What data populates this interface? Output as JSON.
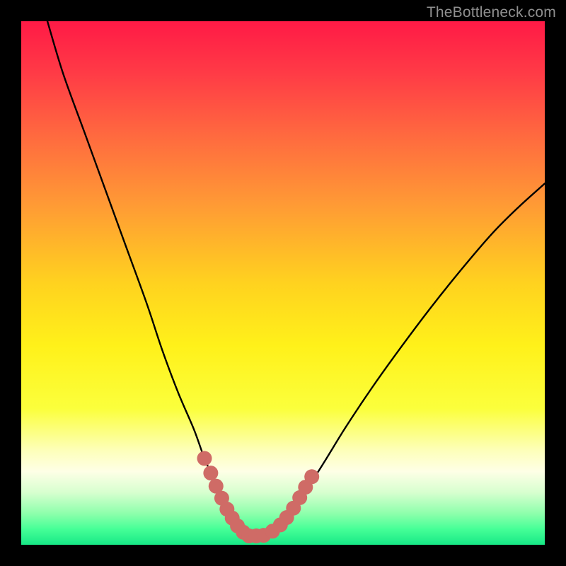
{
  "watermark": "TheBottleneck.com",
  "colors": {
    "frame": "#000000",
    "curve_stroke": "#000000",
    "marker_fill": "#cf6b66",
    "gradient_stops": [
      {
        "offset": 0.0,
        "color": "#ff1a46"
      },
      {
        "offset": 0.1,
        "color": "#ff3b46"
      },
      {
        "offset": 0.22,
        "color": "#ff6a3f"
      },
      {
        "offset": 0.35,
        "color": "#ff9a35"
      },
      {
        "offset": 0.5,
        "color": "#ffd21f"
      },
      {
        "offset": 0.62,
        "color": "#fff11a"
      },
      {
        "offset": 0.74,
        "color": "#fbff3c"
      },
      {
        "offset": 0.82,
        "color": "#fdffba"
      },
      {
        "offset": 0.86,
        "color": "#feffe6"
      },
      {
        "offset": 0.9,
        "color": "#d7ffcf"
      },
      {
        "offset": 0.94,
        "color": "#8effac"
      },
      {
        "offset": 0.97,
        "color": "#46ff97"
      },
      {
        "offset": 1.0,
        "color": "#17e886"
      }
    ]
  },
  "chart_data": {
    "type": "line",
    "title": "",
    "xlabel": "",
    "ylabel": "",
    "xlim": [
      0,
      100
    ],
    "ylim": [
      0,
      100
    ],
    "grid": false,
    "legend": false,
    "series": [
      {
        "name": "left-branch",
        "x": [
          5,
          8,
          12,
          16,
          20,
          24,
          27,
          30,
          33,
          35,
          37,
          38.5,
          40,
          41.5,
          43
        ],
        "y": [
          100,
          90,
          79,
          68,
          57,
          46,
          37,
          29,
          22,
          16.5,
          12,
          8.5,
          5.5,
          3.2,
          1.6
        ]
      },
      {
        "name": "right-branch",
        "x": [
          43,
          46,
          48,
          50,
          52,
          54.5,
          58,
          62,
          67,
          72,
          78,
          84,
          90,
          95,
          100
        ],
        "y": [
          1.6,
          1.8,
          2.5,
          4.2,
          6.8,
          10.5,
          16,
          22.5,
          30,
          37,
          45,
          52.5,
          59.5,
          64.5,
          69
        ]
      }
    ],
    "markers": {
      "name": "bottom-markers",
      "points": [
        {
          "x": 35.0,
          "y": 16.5
        },
        {
          "x": 36.2,
          "y": 13.7
        },
        {
          "x": 37.2,
          "y": 11.2
        },
        {
          "x": 38.3,
          "y": 8.9
        },
        {
          "x": 39.3,
          "y": 6.8
        },
        {
          "x": 40.3,
          "y": 5.1
        },
        {
          "x": 41.3,
          "y": 3.6
        },
        {
          "x": 42.4,
          "y": 2.4
        },
        {
          "x": 43.5,
          "y": 1.7
        },
        {
          "x": 44.9,
          "y": 1.7
        },
        {
          "x": 46.3,
          "y": 1.8
        },
        {
          "x": 48.0,
          "y": 2.6
        },
        {
          "x": 49.5,
          "y": 3.8
        },
        {
          "x": 50.7,
          "y": 5.2
        },
        {
          "x": 52.0,
          "y": 7.0
        },
        {
          "x": 53.2,
          "y": 9.0
        },
        {
          "x": 54.3,
          "y": 11.0
        },
        {
          "x": 55.5,
          "y": 13.0
        }
      ]
    }
  }
}
